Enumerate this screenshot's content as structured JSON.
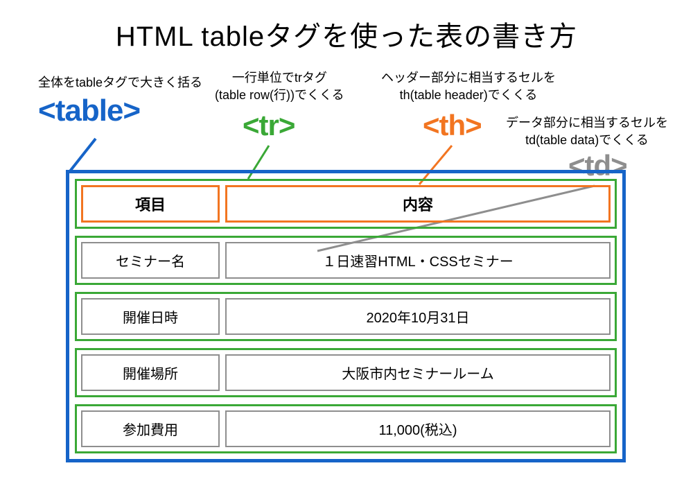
{
  "title": "HTML tableタグを使った表の書き方",
  "labels": {
    "table_desc": "全体をtableタグで大きく括る",
    "table_tag": "<table>",
    "tr_desc_line1": "一行単位でtrタグ",
    "tr_desc_line2": "(table row(行))でくくる",
    "tr_tag": "<tr>",
    "th_desc_line1": "ヘッダー部分に相当するセルを",
    "th_desc_line2": "th(table header)でくくる",
    "th_tag": "<th>",
    "td_desc_line1": "データ部分に相当するセルを",
    "td_desc_line2": "td(table data)でくくる",
    "td_tag": "<td>"
  },
  "table": {
    "headers": {
      "col1": "項目",
      "col2": "内容"
    },
    "rows": [
      {
        "col1": "セミナー名",
        "col2": "１日速習HTML・CSSセミナー"
      },
      {
        "col1": "開催日時",
        "col2": "2020年10月31日"
      },
      {
        "col1": "開催場所",
        "col2": "大阪市内セミナールーム"
      },
      {
        "col1": "参加費用",
        "col2": "11,000(税込)"
      }
    ]
  },
  "colors": {
    "table": "#1664c8",
    "tr": "#3aa836",
    "th": "#f27521",
    "td": "#8e8e8e"
  }
}
